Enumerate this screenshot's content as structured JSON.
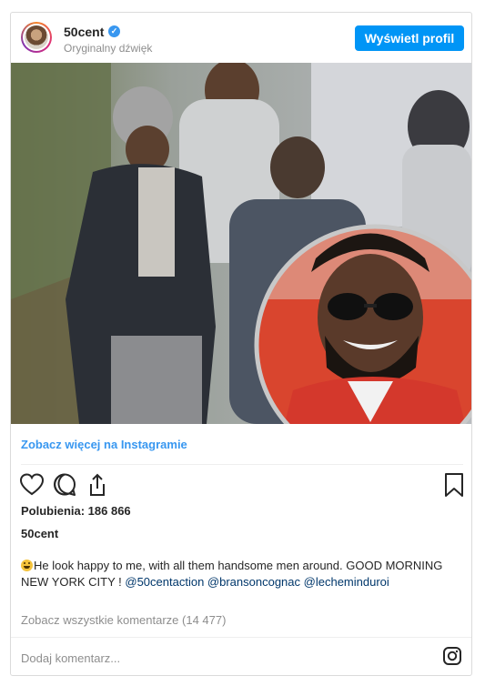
{
  "header": {
    "username": "50cent",
    "audio": "Oryginalny dźwięk",
    "view_profile": "Wyświetl profil"
  },
  "post": {
    "more_on_instagram": "Zobacz więcej na Instagramie",
    "likes": "Polubienia: 186 866",
    "author": "50cent",
    "caption_text": "He look happy to me, with all them handsome men around. GOOD MORNING NEW YORK CITY ! ",
    "mentions": [
      "@50centaction",
      "@bransoncognac",
      "@lecheminduroi"
    ],
    "view_comments": "Zobacz wszystkie komentarze (14 477)",
    "add_comment_placeholder": "Dodaj komentarz..."
  },
  "icons": {
    "verified": "verified-badge-icon",
    "like": "heart-icon",
    "comment": "comment-icon",
    "share": "share-icon",
    "save": "bookmark-icon",
    "instagram": "instagram-logo-icon",
    "caption_emoji": "laughing-face-emoji"
  },
  "colors": {
    "accent": "#0095f6",
    "link": "#3897f0",
    "mention": "#00376b",
    "muted": "#8e8e8e"
  }
}
